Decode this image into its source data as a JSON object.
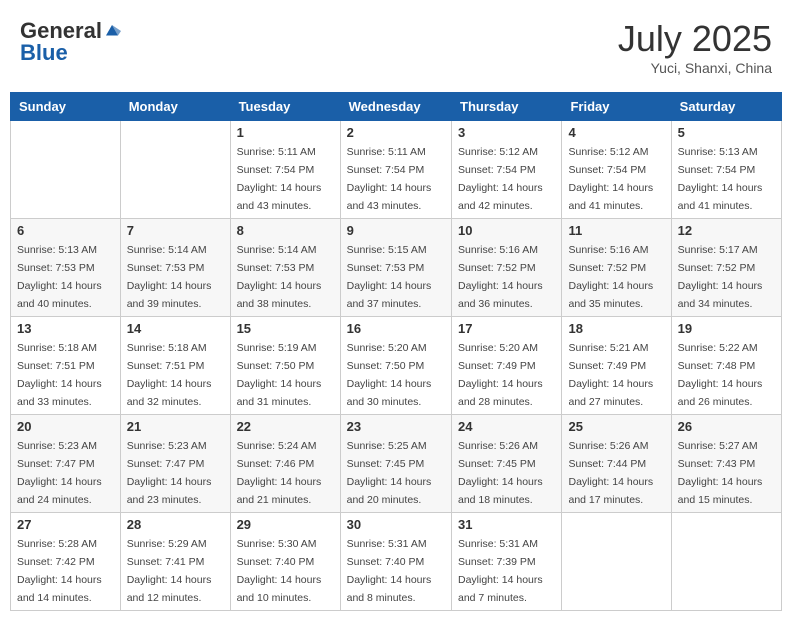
{
  "logo": {
    "general": "General",
    "blue": "Blue"
  },
  "title": {
    "month": "July 2025",
    "location": "Yuci, Shanxi, China"
  },
  "weekdays": [
    "Sunday",
    "Monday",
    "Tuesday",
    "Wednesday",
    "Thursday",
    "Friday",
    "Saturday"
  ],
  "weeks": [
    [
      {
        "day": "",
        "sunrise": "",
        "sunset": "",
        "daylight": ""
      },
      {
        "day": "",
        "sunrise": "",
        "sunset": "",
        "daylight": ""
      },
      {
        "day": "1",
        "sunrise": "Sunrise: 5:11 AM",
        "sunset": "Sunset: 7:54 PM",
        "daylight": "Daylight: 14 hours and 43 minutes."
      },
      {
        "day": "2",
        "sunrise": "Sunrise: 5:11 AM",
        "sunset": "Sunset: 7:54 PM",
        "daylight": "Daylight: 14 hours and 43 minutes."
      },
      {
        "day": "3",
        "sunrise": "Sunrise: 5:12 AM",
        "sunset": "Sunset: 7:54 PM",
        "daylight": "Daylight: 14 hours and 42 minutes."
      },
      {
        "day": "4",
        "sunrise": "Sunrise: 5:12 AM",
        "sunset": "Sunset: 7:54 PM",
        "daylight": "Daylight: 14 hours and 41 minutes."
      },
      {
        "day": "5",
        "sunrise": "Sunrise: 5:13 AM",
        "sunset": "Sunset: 7:54 PM",
        "daylight": "Daylight: 14 hours and 41 minutes."
      }
    ],
    [
      {
        "day": "6",
        "sunrise": "Sunrise: 5:13 AM",
        "sunset": "Sunset: 7:53 PM",
        "daylight": "Daylight: 14 hours and 40 minutes."
      },
      {
        "day": "7",
        "sunrise": "Sunrise: 5:14 AM",
        "sunset": "Sunset: 7:53 PM",
        "daylight": "Daylight: 14 hours and 39 minutes."
      },
      {
        "day": "8",
        "sunrise": "Sunrise: 5:14 AM",
        "sunset": "Sunset: 7:53 PM",
        "daylight": "Daylight: 14 hours and 38 minutes."
      },
      {
        "day": "9",
        "sunrise": "Sunrise: 5:15 AM",
        "sunset": "Sunset: 7:53 PM",
        "daylight": "Daylight: 14 hours and 37 minutes."
      },
      {
        "day": "10",
        "sunrise": "Sunrise: 5:16 AM",
        "sunset": "Sunset: 7:52 PM",
        "daylight": "Daylight: 14 hours and 36 minutes."
      },
      {
        "day": "11",
        "sunrise": "Sunrise: 5:16 AM",
        "sunset": "Sunset: 7:52 PM",
        "daylight": "Daylight: 14 hours and 35 minutes."
      },
      {
        "day": "12",
        "sunrise": "Sunrise: 5:17 AM",
        "sunset": "Sunset: 7:52 PM",
        "daylight": "Daylight: 14 hours and 34 minutes."
      }
    ],
    [
      {
        "day": "13",
        "sunrise": "Sunrise: 5:18 AM",
        "sunset": "Sunset: 7:51 PM",
        "daylight": "Daylight: 14 hours and 33 minutes."
      },
      {
        "day": "14",
        "sunrise": "Sunrise: 5:18 AM",
        "sunset": "Sunset: 7:51 PM",
        "daylight": "Daylight: 14 hours and 32 minutes."
      },
      {
        "day": "15",
        "sunrise": "Sunrise: 5:19 AM",
        "sunset": "Sunset: 7:50 PM",
        "daylight": "Daylight: 14 hours and 31 minutes."
      },
      {
        "day": "16",
        "sunrise": "Sunrise: 5:20 AM",
        "sunset": "Sunset: 7:50 PM",
        "daylight": "Daylight: 14 hours and 30 minutes."
      },
      {
        "day": "17",
        "sunrise": "Sunrise: 5:20 AM",
        "sunset": "Sunset: 7:49 PM",
        "daylight": "Daylight: 14 hours and 28 minutes."
      },
      {
        "day": "18",
        "sunrise": "Sunrise: 5:21 AM",
        "sunset": "Sunset: 7:49 PM",
        "daylight": "Daylight: 14 hours and 27 minutes."
      },
      {
        "day": "19",
        "sunrise": "Sunrise: 5:22 AM",
        "sunset": "Sunset: 7:48 PM",
        "daylight": "Daylight: 14 hours and 26 minutes."
      }
    ],
    [
      {
        "day": "20",
        "sunrise": "Sunrise: 5:23 AM",
        "sunset": "Sunset: 7:47 PM",
        "daylight": "Daylight: 14 hours and 24 minutes."
      },
      {
        "day": "21",
        "sunrise": "Sunrise: 5:23 AM",
        "sunset": "Sunset: 7:47 PM",
        "daylight": "Daylight: 14 hours and 23 minutes."
      },
      {
        "day": "22",
        "sunrise": "Sunrise: 5:24 AM",
        "sunset": "Sunset: 7:46 PM",
        "daylight": "Daylight: 14 hours and 21 minutes."
      },
      {
        "day": "23",
        "sunrise": "Sunrise: 5:25 AM",
        "sunset": "Sunset: 7:45 PM",
        "daylight": "Daylight: 14 hours and 20 minutes."
      },
      {
        "day": "24",
        "sunrise": "Sunrise: 5:26 AM",
        "sunset": "Sunset: 7:45 PM",
        "daylight": "Daylight: 14 hours and 18 minutes."
      },
      {
        "day": "25",
        "sunrise": "Sunrise: 5:26 AM",
        "sunset": "Sunset: 7:44 PM",
        "daylight": "Daylight: 14 hours and 17 minutes."
      },
      {
        "day": "26",
        "sunrise": "Sunrise: 5:27 AM",
        "sunset": "Sunset: 7:43 PM",
        "daylight": "Daylight: 14 hours and 15 minutes."
      }
    ],
    [
      {
        "day": "27",
        "sunrise": "Sunrise: 5:28 AM",
        "sunset": "Sunset: 7:42 PM",
        "daylight": "Daylight: 14 hours and 14 minutes."
      },
      {
        "day": "28",
        "sunrise": "Sunrise: 5:29 AM",
        "sunset": "Sunset: 7:41 PM",
        "daylight": "Daylight: 14 hours and 12 minutes."
      },
      {
        "day": "29",
        "sunrise": "Sunrise: 5:30 AM",
        "sunset": "Sunset: 7:40 PM",
        "daylight": "Daylight: 14 hours and 10 minutes."
      },
      {
        "day": "30",
        "sunrise": "Sunrise: 5:31 AM",
        "sunset": "Sunset: 7:40 PM",
        "daylight": "Daylight: 14 hours and 8 minutes."
      },
      {
        "day": "31",
        "sunrise": "Sunrise: 5:31 AM",
        "sunset": "Sunset: 7:39 PM",
        "daylight": "Daylight: 14 hours and 7 minutes."
      },
      {
        "day": "",
        "sunrise": "",
        "sunset": "",
        "daylight": ""
      },
      {
        "day": "",
        "sunrise": "",
        "sunset": "",
        "daylight": ""
      }
    ]
  ]
}
